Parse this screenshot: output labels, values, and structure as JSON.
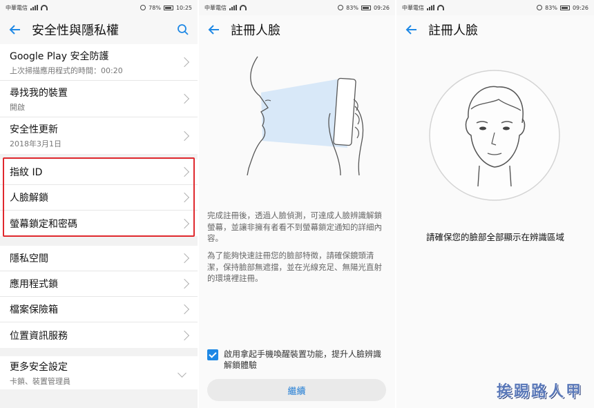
{
  "colors": {
    "accent": "#1e88e5",
    "highlight": "#e0282d"
  },
  "panels": [
    {
      "status": {
        "carrier": "中華電信",
        "battery": "78%",
        "time": "10:25"
      },
      "title": "安全性與隱私權",
      "groups": [
        [
          {
            "title": "Google Play 安全防護",
            "subtitle": "上次掃描應用程式的時間：00:20"
          },
          {
            "title": "尋找我的裝置",
            "subtitle": "開啟"
          },
          {
            "title": "安全性更新",
            "subtitle": "2018年3月1日"
          }
        ],
        [
          {
            "title": "指紋 ID"
          },
          {
            "title": "人臉解鎖"
          },
          {
            "title": "螢幕鎖定和密碼"
          }
        ],
        [
          {
            "title": "隱私空間"
          },
          {
            "title": "應用程式鎖"
          },
          {
            "title": "檔案保險箱"
          },
          {
            "title": "位置資訊服務"
          }
        ],
        [
          {
            "title": "更多安全設定",
            "subtitle": "卡鎖、裝置管理員"
          }
        ]
      ]
    },
    {
      "status": {
        "carrier": "中華電信",
        "battery": "83%",
        "time": "09:26"
      },
      "title": "註冊人臉",
      "desc1": "完成註冊後，透過人臉偵測，可達成人臉辨識解鎖螢幕，並讓非擁有者看不到螢幕鎖定通知的詳細內容。",
      "desc2": "為了能夠快速註冊您的臉部特徵，請確保鏡頭清潔，保持臉部無遮擋，並在光線充足、無陽光直射的環境裡註冊。",
      "checkbox_label": "啟用拿起手機喚醒裝置功能，提升人臉辨識解鎖體驗",
      "button": "繼續"
    },
    {
      "status": {
        "carrier": "中華電信",
        "battery": "83%",
        "time": "09:26"
      },
      "title": "註冊人臉",
      "instruction": "請確保您的臉部全部顯示在辨識區域",
      "watermark": "挨踢路人甲"
    }
  ]
}
